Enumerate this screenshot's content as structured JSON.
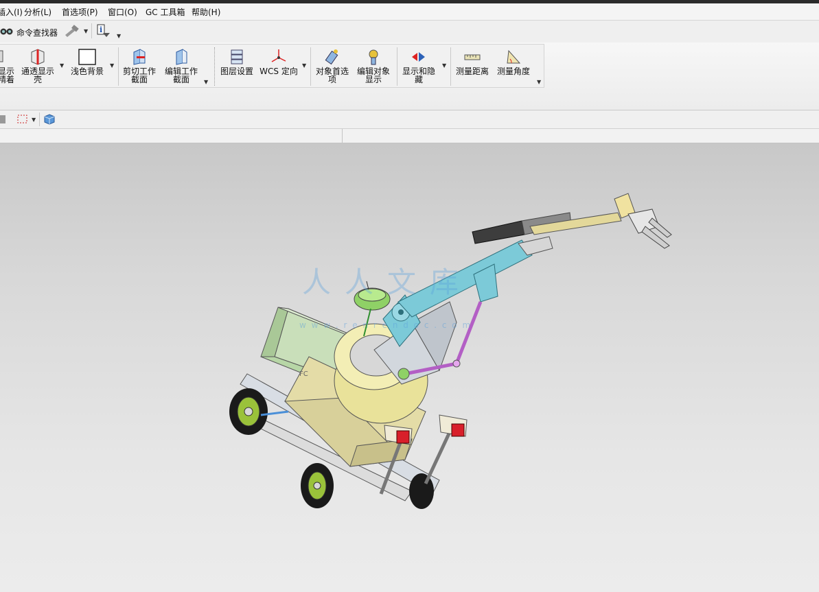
{
  "menubar": {
    "items": [
      "插入(I)",
      "分析(L)",
      "首选项(P)",
      "窗口(O)",
      "GC 工具箱",
      "帮助(H)"
    ]
  },
  "quick_access": {
    "command_finder_label": "命令查找器"
  },
  "ribbon": {
    "buttons": [
      {
        "label": "显示\n精着",
        "icon": "display-icon"
      },
      {
        "label": "通透显示\n壳",
        "icon": "transparent-shell-icon"
      },
      {
        "label": "浅色背景",
        "icon": "light-background-icon"
      },
      {
        "label": "剪切工作\n截面",
        "icon": "clip-section-icon"
      },
      {
        "label": "编辑工作\n截面",
        "icon": "edit-section-icon"
      },
      {
        "label": "图层设置",
        "icon": "layer-settings-icon"
      },
      {
        "label": "WCS 定向",
        "icon": "wcs-orient-icon"
      },
      {
        "label": "对象首选\n项",
        "icon": "object-preferences-icon"
      },
      {
        "label": "编辑对象\n显示",
        "icon": "edit-object-display-icon"
      },
      {
        "label": "显示和隐\n藏",
        "icon": "show-hide-icon"
      },
      {
        "label": "测量距离",
        "icon": "measure-distance-icon"
      },
      {
        "label": "测量角度",
        "icon": "measure-angle-icon"
      }
    ]
  },
  "viewport": {
    "model": "mobile-robot-arm-assembly",
    "watermark": "人人文库",
    "watermark_url": "w w w . r e n r e n d o c . c o m",
    "part_label": "FC"
  },
  "colors": {
    "arm_cyan": "#7ccad8",
    "base_yellow": "#e9e29a",
    "box_green": "#b7d6a6",
    "link_purple": "#b35fc5",
    "light_red": "#d81f2a"
  }
}
